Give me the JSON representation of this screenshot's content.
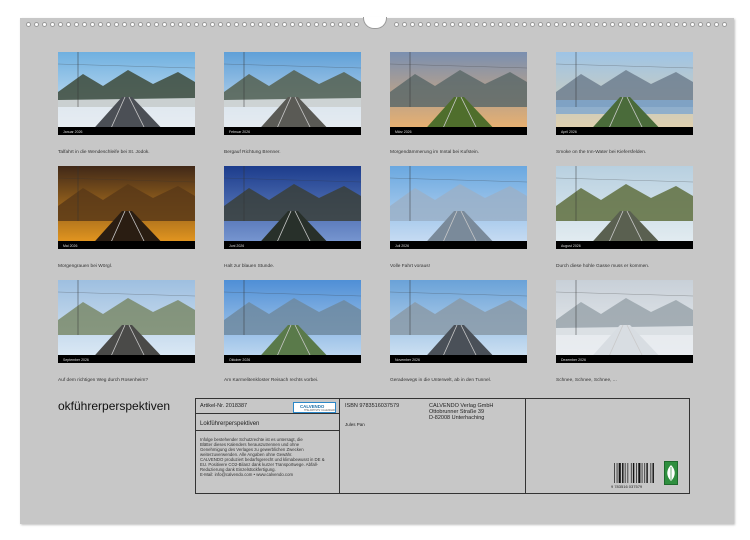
{
  "photos": [
    {
      "caption": "Talfahrt in die Wendeschleife bei St. Jodok.",
      "month": "Januar 2026"
    },
    {
      "caption": "Bergauf Richtung Brenner.",
      "month": "Februar 2026"
    },
    {
      "caption": "Morgendämmerung im Inntal bei Kufstein.",
      "month": "März 2026"
    },
    {
      "caption": "Smoke on the Inn-Water bei Kiefersfelden.",
      "month": "April 2026"
    },
    {
      "caption": "Morgengrauen bei Wörgl.",
      "month": "Mai 2026"
    },
    {
      "caption": "Halt zur blauen Stunde.",
      "month": "Juni 2026"
    },
    {
      "caption": "Volle Fahrt voraus!",
      "month": "Juli 2026"
    },
    {
      "caption": "Durch diese hohle Gasse muss er kommen.",
      "month": "August 2026"
    },
    {
      "caption": "Auf dem richtigen Weg durch Rosenheim?",
      "month": "September 2026"
    },
    {
      "caption": "Am Karmelitenkloster Reisach rechts vorbei.",
      "month": "Oktober 2026"
    },
    {
      "caption": "Geradewegs in die Unterwelt, ab in den Tunnel.",
      "month": "November 2026"
    },
    {
      "caption": "Schnee, Schnee, Schnee, ...",
      "month": "Dezember 2026"
    }
  ],
  "title": "okführerperspektiven",
  "info": {
    "artikel_label": "Artikel-Nr. 2018387",
    "logo_text": "CALVENDO",
    "logo_sub": "THE ARTISTS' CALENDAR",
    "subtitle": "Lokführerperspektiven",
    "isbn": "ISBN 9783516037579",
    "publisher_1": "CALVENDO Verlag GmbH",
    "publisher_2": "Ottobrunner Straße 39",
    "publisher_3": "D-82008 Unterhaching",
    "author": "Jules Pan",
    "disclaimer": [
      "Infolge bestehender Schutzrechte ist es untersagt, die",
      "Blätter dieses Kalenders herauszutrennen und ohne",
      "Genehmigung des Verlages zu gewerblichen Zwecken",
      "weiterzuverwenden. Alle Angaben ohne Gewähr.",
      "CALVENDO produziert bedarfsgerecht und klimabewusst in DE &",
      "EU. Positivere CO2-Bilanz dank kurzer Transportwege. Abfall-",
      "Reduzierung dank Einzelstückfertigung.",
      "E-Mail: info@calvendo.com • www.calvendo.com"
    ],
    "barcode_number": "9 783516 037579"
  }
}
